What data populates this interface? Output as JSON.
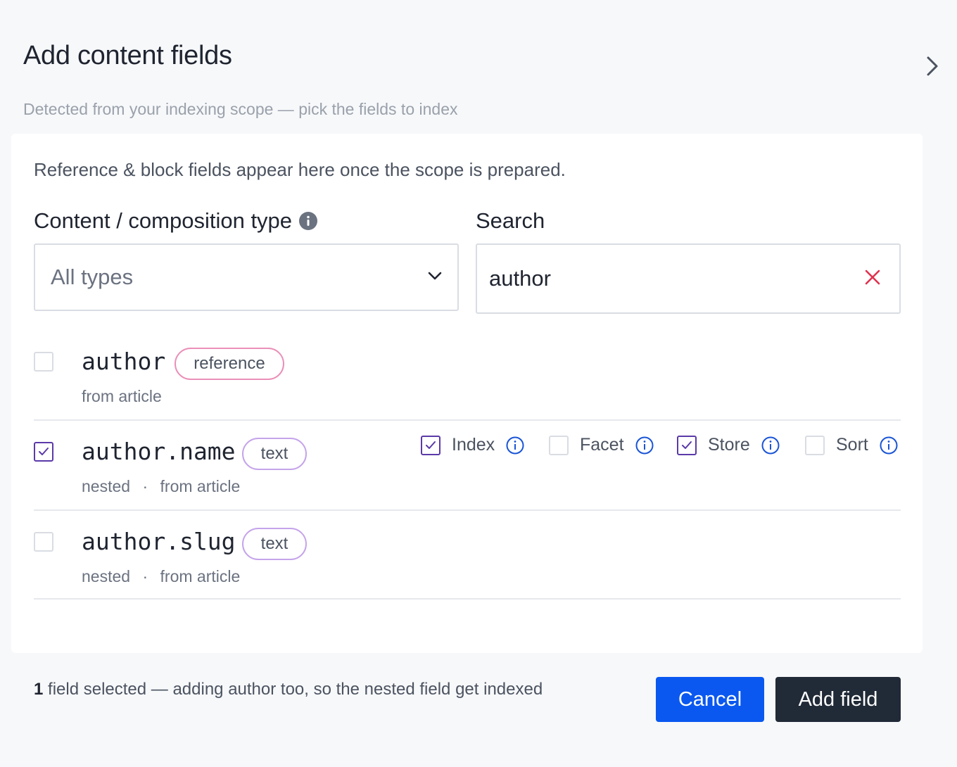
{
  "panel": {
    "title": "Add content fields",
    "subtitle": "Detected from your indexing scope — pick the fields to index"
  },
  "card": {
    "info_text": "Reference & block fields appear here once the scope is prepared.",
    "type_label": "Content / composition type",
    "type_select_value": "All types",
    "search_label": "Search",
    "search_value": "author"
  },
  "fields": [
    {
      "name": "author",
      "type": "reference",
      "origin": "from article",
      "nested": "",
      "checked": false
    },
    {
      "name": "author.name",
      "type": "text",
      "nested": "nested",
      "separator": "·",
      "origin": "from article",
      "checked": true
    },
    {
      "name": "author.slug",
      "type": "text",
      "nested": "nested",
      "separator": "·",
      "origin": "from article",
      "checked": false
    }
  ],
  "options": [
    {
      "label": "Index",
      "checked": true
    },
    {
      "label": "Facet",
      "checked": false
    },
    {
      "label": "Store",
      "checked": true
    },
    {
      "label": "Sort",
      "checked": false
    }
  ],
  "footer": {
    "count": "1",
    "message": " field selected — adding author too, so the nested field get indexed",
    "cancel_label": "Cancel",
    "add_label": "Add field"
  },
  "colors": {
    "primary": "#0a58f0",
    "dark": "#212a37",
    "check": "#5b3aa8",
    "info_icon": "#1a55d6",
    "clear_icon": "#e0324e",
    "reference_pill": "#ea8fb8",
    "text_pill": "#c5a4ea"
  },
  "icons": {
    "collapse": "chevron-right-icon",
    "select": "chevron-down-icon",
    "clear": "close-icon",
    "info": "info-icon"
  }
}
